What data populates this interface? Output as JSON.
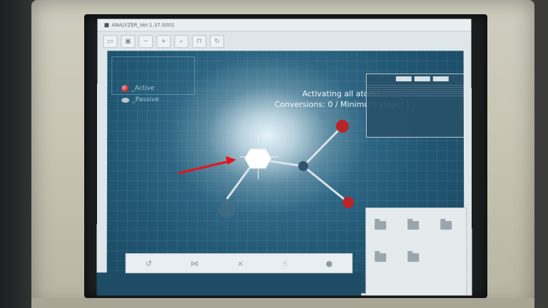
{
  "window": {
    "title": "ANALYZER_Ver.1.37.0001"
  },
  "toolbar": {
    "icons": [
      "folder-icon",
      "save-icon",
      "minus-icon",
      "plus-icon",
      "magnify-icon",
      "lock-icon",
      "reset-icon"
    ]
  },
  "legend": {
    "active_label": "_Active",
    "passive_label": "_Passive"
  },
  "status": {
    "line1": "Activating all atoms.",
    "line2": "Conversions: 0 / Minimum steps: 1"
  },
  "colors": {
    "active_atom": "#b9242b",
    "selected_atom": "#ffffff",
    "bond": "#d9e4ea",
    "cursor_arrow": "#e3141b"
  }
}
